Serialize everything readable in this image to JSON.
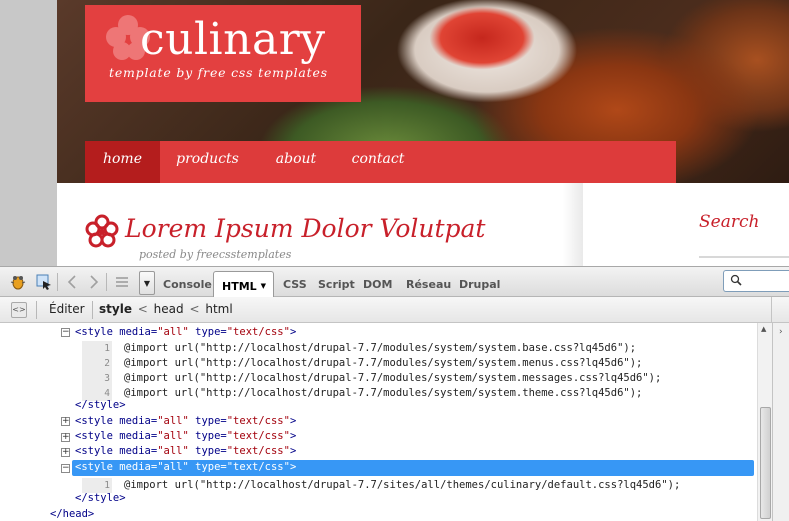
{
  "site": {
    "logo_title": "culinary",
    "logo_tagline": "template by free css templates",
    "nav": {
      "home": "home",
      "products": "products",
      "about": "about",
      "contact": "contact"
    },
    "post_title": "Lorem Ipsum Dolor Volutpat",
    "post_meta": "posted by freecsstemplates",
    "search_heading": "Search",
    "colors": {
      "brand_red": "#e34040",
      "nav_active": "#b41d1d",
      "title_red": "#c8202a"
    }
  },
  "firebug": {
    "tabs": {
      "console": "Console",
      "html": "HTML",
      "css": "CSS",
      "script": "Script",
      "dom": "DOM",
      "reseau": "Réseau",
      "drupal": "Drupal"
    },
    "icons": {
      "firebug": "firebug-icon",
      "inspect": "inspect-icon",
      "back": "chevron-left-icon",
      "forward": "chevron-right-icon",
      "list": "list-icon",
      "search": "search-icon"
    },
    "breadcrumb": {
      "edit": "Éditer",
      "path": [
        "style",
        "head",
        "html"
      ],
      "separator": "<"
    },
    "source": {
      "style_open_prefix": "<style media=",
      "style_media": "\"all\"",
      "style_type_attr": " type=",
      "style_type": "\"text/css\"",
      "style_open_suffix": ">",
      "style_close": "</style>",
      "head_close": "</head>",
      "block1_lines": [
        {
          "no": "1",
          "code": "@import url(\"http://localhost/drupal-7.7/modules/system/system.base.css?lq45d6\");"
        },
        {
          "no": "2",
          "code": "@import url(\"http://localhost/drupal-7.7/modules/system/system.menus.css?lq45d6\");"
        },
        {
          "no": "3",
          "code": "@import url(\"http://localhost/drupal-7.7/modules/system/system.messages.css?lq45d6\");"
        },
        {
          "no": "4",
          "code": "@import url(\"http://localhost/drupal-7.7/modules/system/system.theme.css?lq45d6\");"
        }
      ],
      "block5_lines": [
        {
          "no": "1",
          "code": "@import url(\"http://localhost/drupal-7.7/sites/all/themes/culinary/default.css?lq45d6\");"
        }
      ],
      "twisty_expanded": "−",
      "twisty_collapsed": "+"
    },
    "colors": {
      "selection": "#3797f5",
      "tag": "#000088",
      "value": "#a3000c"
    }
  }
}
